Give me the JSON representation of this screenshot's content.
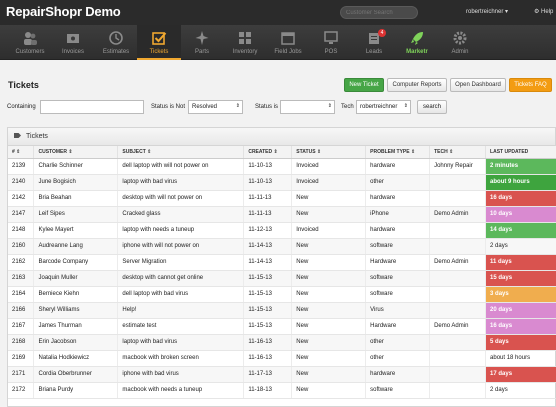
{
  "app": {
    "title": "RepairShopr Demo",
    "search_placeholder": "Customer Search",
    "user": "robertreichner ▾",
    "help": "⚙ Help"
  },
  "nav": [
    {
      "label": "Customers",
      "icon": "customers-icon"
    },
    {
      "label": "Invoices",
      "icon": "invoices-icon"
    },
    {
      "label": "Estimates",
      "icon": "clock-icon"
    },
    {
      "label": "Tickets",
      "icon": "check-icon",
      "active": true
    },
    {
      "label": "Parts",
      "icon": "plane-icon"
    },
    {
      "label": "Inventory",
      "icon": "inventory-icon"
    },
    {
      "label": "Field Jobs",
      "icon": "calendar-icon"
    },
    {
      "label": "POS",
      "icon": "monitor-icon"
    },
    {
      "label": "Leads",
      "icon": "leads-icon",
      "badge": "4"
    },
    {
      "label": "Marketr",
      "icon": "rocket-icon"
    },
    {
      "label": "Admin",
      "icon": "gear-icon"
    }
  ],
  "page": {
    "title": "Tickets",
    "buttons": {
      "new": "New Ticket",
      "reports": "Computer Reports",
      "dashboard": "Open Dashboard",
      "faq": "Tickets FAQ"
    }
  },
  "filters": {
    "containing_label": "Containing",
    "containing_value": "",
    "status_not_label": "Status is Not",
    "status_not_value": "Resolved",
    "status_label": "Status is",
    "status_value": "",
    "tech_label": "Tech",
    "tech_value": "robertreichner",
    "search_button": "search"
  },
  "panel": {
    "title": "Tickets"
  },
  "table": {
    "columns": [
      "# ⇕",
      "CUSTOMER ⇕",
      "SUBJECT ⇕",
      "CREATED ⇕",
      "STATUS ⇕",
      "PROBLEM TYPE ⇕",
      "TECH ⇕",
      "LAST UPDATED"
    ],
    "rows": [
      {
        "num": "2139",
        "customer": "Charlie Schinner",
        "subject": "dell laptop with will not power on",
        "created": "11-10-13",
        "status": "Invoiced",
        "problem": "hardware",
        "tech": "Johnny Repair",
        "updated": "2 minutes",
        "color": "#5cb85c"
      },
      {
        "num": "2140",
        "customer": "June Bogisich",
        "subject": "laptop with bad virus",
        "created": "11-10-13",
        "status": "Invoiced",
        "problem": "other",
        "tech": "",
        "updated": "about 9 hours",
        "color": "#3ea43e"
      },
      {
        "num": "2142",
        "customer": "Bria Beahan",
        "subject": "desktop with will not power on",
        "created": "11-11-13",
        "status": "New",
        "problem": "hardware",
        "tech": "",
        "updated": "16 days",
        "color": "#d9534f"
      },
      {
        "num": "2147",
        "customer": "Leif Sipes",
        "subject": "Cracked glass",
        "created": "11-11-13",
        "status": "New",
        "problem": "iPhone",
        "tech": "Demo Admin",
        "updated": "10 days",
        "color": "#d98ad0"
      },
      {
        "num": "2148",
        "customer": "Kylee Mayert",
        "subject": "laptop with needs a tuneup",
        "created": "11-12-13",
        "status": "Invoiced",
        "problem": "hardware",
        "tech": "",
        "updated": "14 days",
        "color": "#5cb85c"
      },
      {
        "num": "2160",
        "customer": "Audreanne Lang",
        "subject": "iphone with will not power on",
        "created": "11-14-13",
        "status": "New",
        "problem": "software",
        "tech": "",
        "updated": "2 days",
        "color": ""
      },
      {
        "num": "2162",
        "customer": "Barcode Company",
        "subject": "Server Migration",
        "created": "11-14-13",
        "status": "New",
        "problem": "Hardware",
        "tech": "Demo Admin",
        "updated": "11 days",
        "color": "#d9534f"
      },
      {
        "num": "2163",
        "customer": "Joaquin Muller",
        "subject": "desktop with cannot get online",
        "created": "11-15-13",
        "status": "New",
        "problem": "software",
        "tech": "",
        "updated": "15 days",
        "color": "#d9534f"
      },
      {
        "num": "2164",
        "customer": "Berniece Kiehn",
        "subject": "dell laptop with bad virus",
        "created": "11-15-13",
        "status": "New",
        "problem": "software",
        "tech": "",
        "updated": "3 days",
        "color": "#f0ad4e"
      },
      {
        "num": "2166",
        "customer": "Sheryl Williams",
        "subject": "Help!",
        "created": "11-15-13",
        "status": "New",
        "problem": "Virus",
        "tech": "",
        "updated": "20 days",
        "color": "#d98ad0"
      },
      {
        "num": "2167",
        "customer": "James Thurman",
        "subject": "estimate test",
        "created": "11-15-13",
        "status": "New",
        "problem": "Hardware",
        "tech": "Demo Admin",
        "updated": "16 days",
        "color": "#d98ad0"
      },
      {
        "num": "2168",
        "customer": "Erin Jacobson",
        "subject": "laptop with bad virus",
        "created": "11-16-13",
        "status": "New",
        "problem": "other",
        "tech": "",
        "updated": "5 days",
        "color": "#d9534f"
      },
      {
        "num": "2169",
        "customer": "Natalia Hodkiewicz",
        "subject": "macbook with broken screen",
        "created": "11-16-13",
        "status": "New",
        "problem": "other",
        "tech": "",
        "updated": "about 18 hours",
        "color": ""
      },
      {
        "num": "2171",
        "customer": "Cordia Oberbrunner",
        "subject": "iphone with bad virus",
        "created": "11-17-13",
        "status": "New",
        "problem": "hardware",
        "tech": "",
        "updated": "17 days",
        "color": "#d9534f"
      },
      {
        "num": "2172",
        "customer": "Briana Purdy",
        "subject": "macbook with needs a tuneup",
        "created": "11-18-13",
        "status": "New",
        "problem": "software",
        "tech": "",
        "updated": "2 days",
        "color": ""
      }
    ]
  }
}
